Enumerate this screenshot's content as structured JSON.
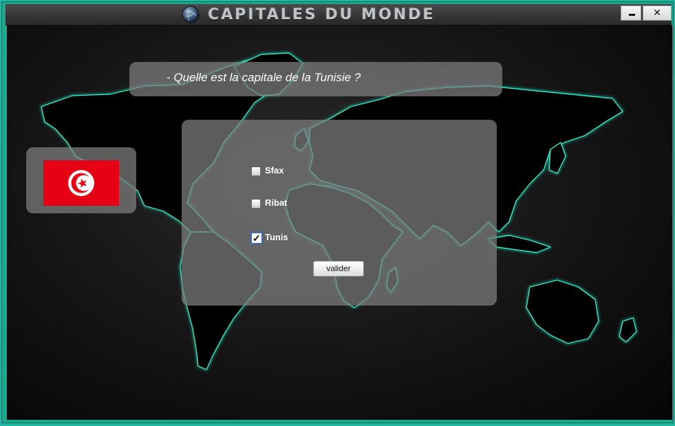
{
  "window": {
    "title": "CAPITALES DU MONDE",
    "close_label": "✕"
  },
  "question": {
    "text": "- Quelle est la capitale de la Tunisie ?"
  },
  "flag": {
    "country": "Tunisie",
    "colors": {
      "field": "#e70013",
      "disc": "#ffffff",
      "crescent": "#e70013"
    }
  },
  "options": [
    {
      "label": "Sfax",
      "checked": false
    },
    {
      "label": "Ribat",
      "checked": false
    },
    {
      "label": "Tunis",
      "checked": true
    }
  ],
  "submit": {
    "label": "valider"
  },
  "theme": {
    "frame": "#1fb79f",
    "map_glow": "#2ee6c4",
    "panel": "rgba(128,128,128,0.72)"
  }
}
